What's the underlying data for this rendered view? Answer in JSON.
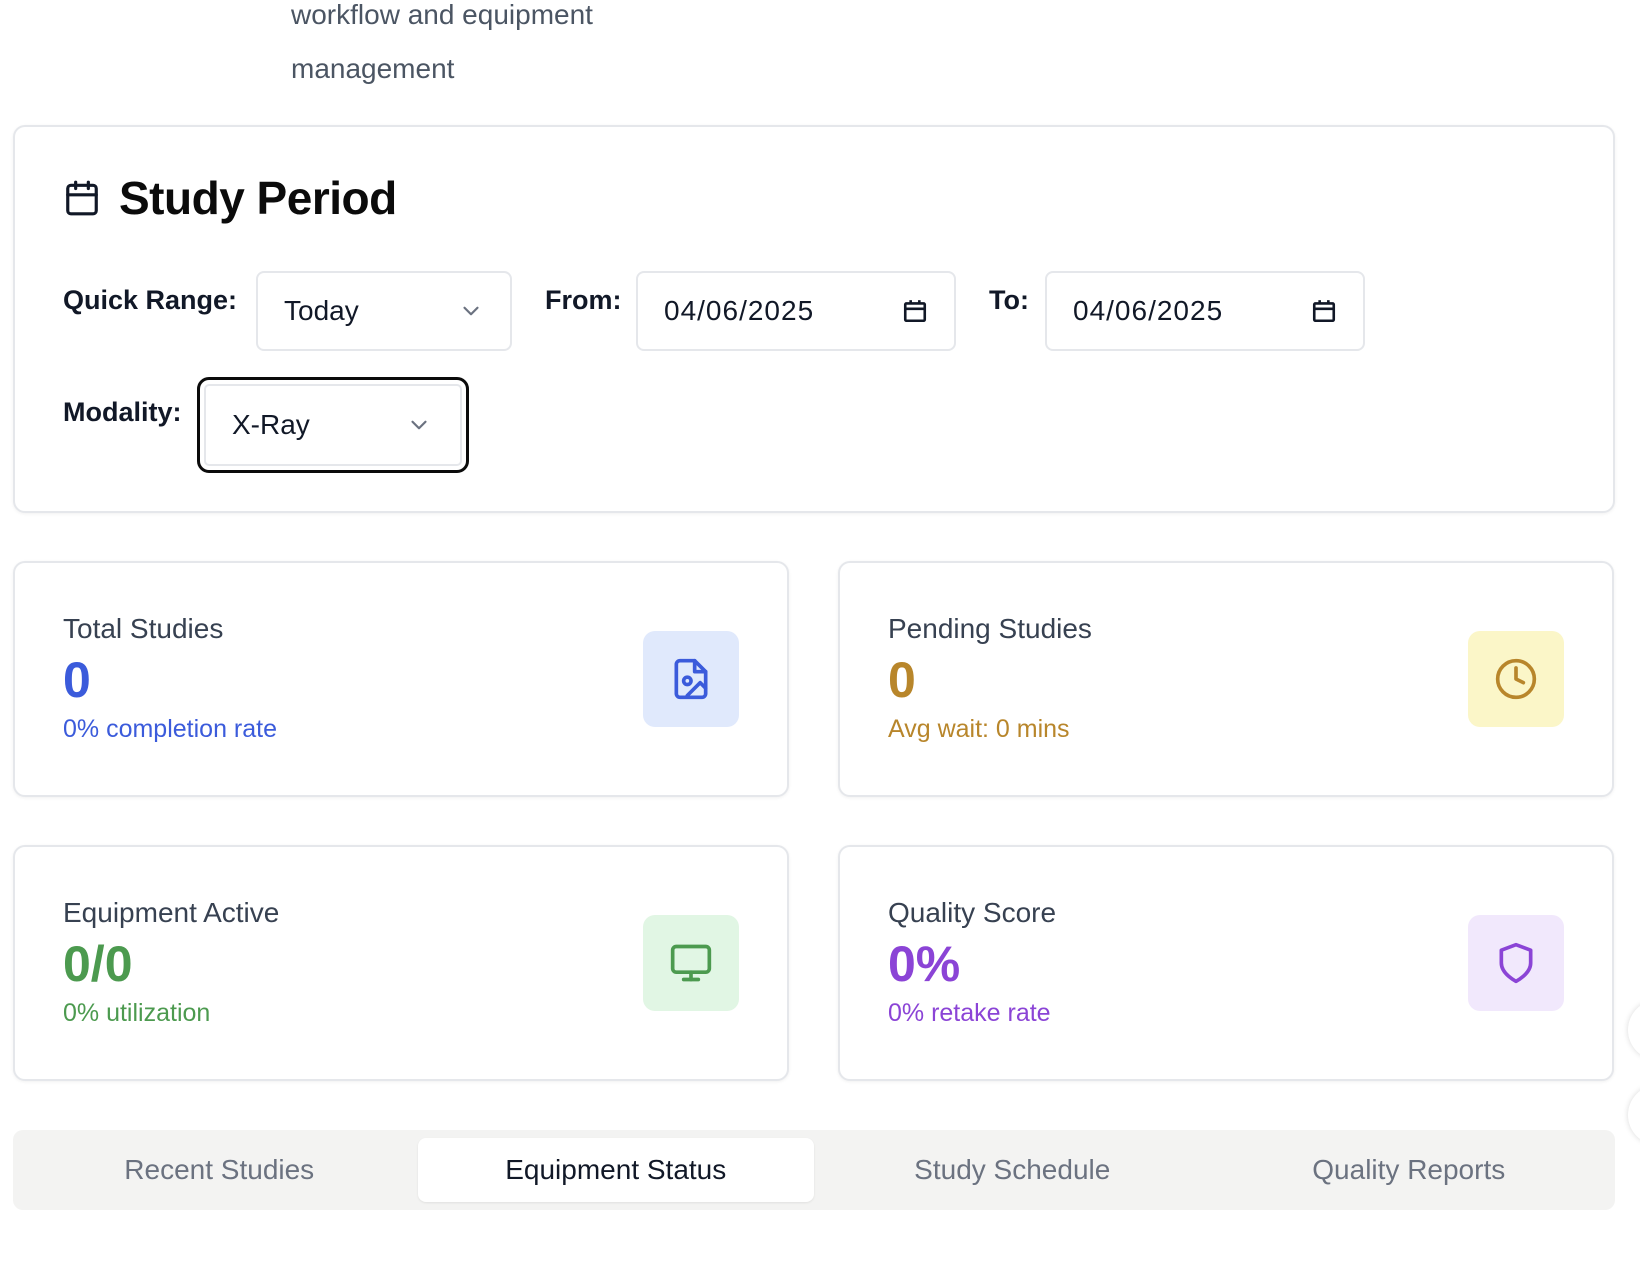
{
  "header": {
    "subtitle_line1": "workflow and equipment",
    "subtitle_line2": "management"
  },
  "study_period": {
    "title": "Study Period",
    "icon": "calendar-icon",
    "quick_range": {
      "label": "Quick Range:",
      "value": "Today"
    },
    "from": {
      "label": "From:",
      "value": "04/06/2025"
    },
    "to": {
      "label": "To:",
      "value": "04/06/2025"
    },
    "modality": {
      "label": "Modality:",
      "value": "X-Ray"
    }
  },
  "stats": {
    "total_studies": {
      "label": "Total Studies",
      "value": "0",
      "sub": "0% completion rate",
      "color": "#3b5bdb",
      "bg": "#e0e9fc",
      "icon": "file-image-icon"
    },
    "pending_studies": {
      "label": "Pending Studies",
      "value": "0",
      "sub": "Avg wait: 0 mins",
      "color": "#b8862b",
      "bg": "#fbf6c8",
      "icon": "clock-icon"
    },
    "equipment_active": {
      "label": "Equipment Active",
      "value": "0/0",
      "sub": "0% utilization",
      "color": "#4c9a4f",
      "bg": "#e1f6e4",
      "icon": "monitor-icon"
    },
    "quality_score": {
      "label": "Quality Score",
      "value": "0%",
      "sub": "0% retake rate",
      "color": "#8b44d6",
      "bg": "#f1e8fc",
      "icon": "shield-icon"
    }
  },
  "tabs": [
    {
      "label": "Recent Studies",
      "active": false
    },
    {
      "label": "Equipment Status",
      "active": true
    },
    {
      "label": "Study Schedule",
      "active": false
    },
    {
      "label": "Quality Reports",
      "active": false
    }
  ]
}
